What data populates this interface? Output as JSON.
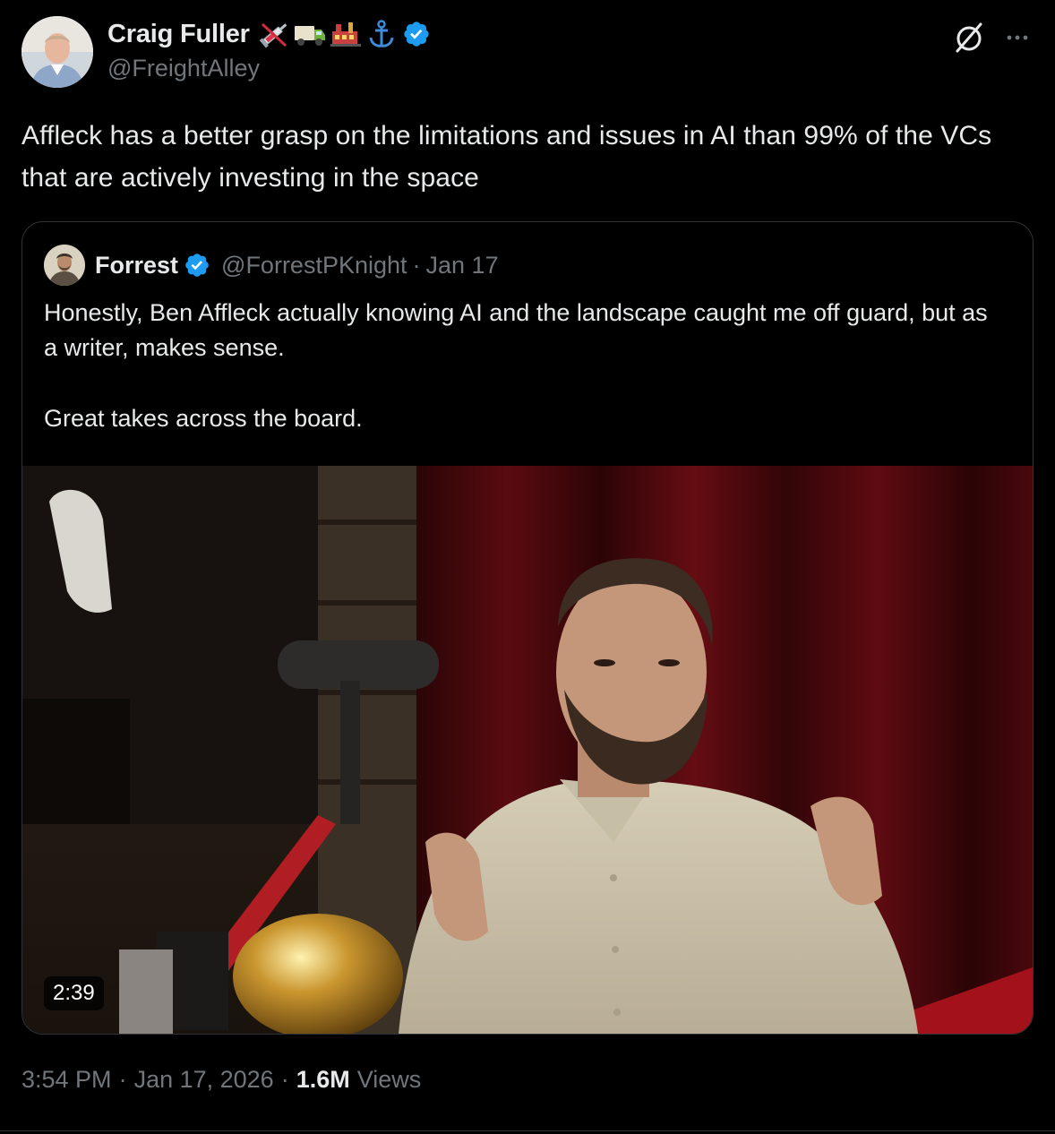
{
  "author": {
    "display_name": "Craig Fuller",
    "emoji_icons": [
      "syringe-icon",
      "delivery-truck-icon",
      "train-factory-icon",
      "anchor-icon"
    ],
    "verified": true,
    "handle": "@FreightAlley"
  },
  "tweet": {
    "text": "Affleck has a better grasp on the limitations and issues in AI than 99% of the VCs that are actively investing in the space"
  },
  "quoted": {
    "display_name": "Forrest",
    "verified": true,
    "handle": "@ForrestPKnight",
    "separator": "·",
    "date": "Jan 17",
    "paragraphs": [
      "Honestly, Ben Affleck actually knowing AI and the landscape caught me off guard, but as a writer, makes sense.",
      "Great takes across the board."
    ],
    "video_duration": "2:39"
  },
  "meta": {
    "time": "3:54 PM",
    "separator": "·",
    "date": "Jan 17, 2026",
    "views_count": "1.6M",
    "views_label": "Views"
  },
  "colors": {
    "background": "#000000",
    "text_primary": "#e7e9ea",
    "text_secondary": "#71767b",
    "verified_blue": "#1d9bf0",
    "border": "#2f3336"
  }
}
